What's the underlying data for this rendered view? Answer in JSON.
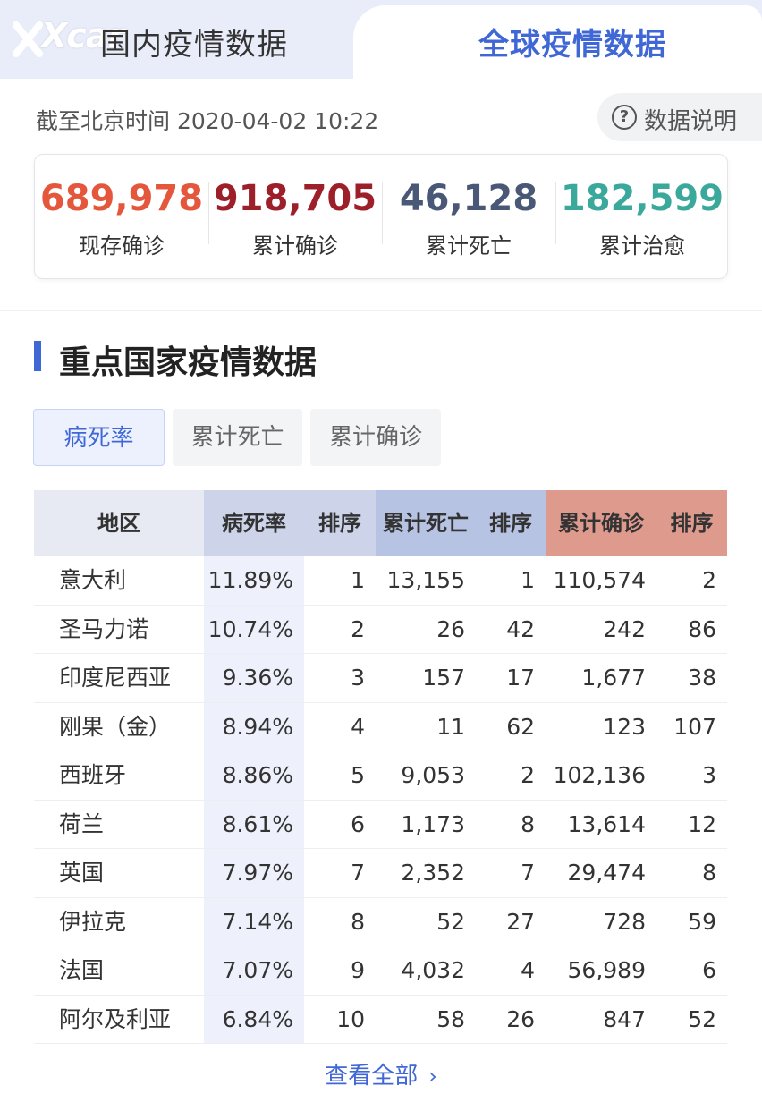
{
  "tabs": {
    "domestic": "国内疫情数据",
    "global": "全球疫情数据"
  },
  "logo": "Xcar",
  "header": {
    "timestamp": "截至北京时间 2020-04-02 10:22",
    "info_label": "数据说明",
    "info_icon": "?"
  },
  "stats": [
    {
      "value": "689,978",
      "label": "现存确诊",
      "color": "#e4573d"
    },
    {
      "value": "918,705",
      "label": "累计确诊",
      "color": "#9c1f2a"
    },
    {
      "value": "46,128",
      "label": "累计死亡",
      "color": "#4a5878"
    },
    {
      "value": "182,599",
      "label": "累计治愈",
      "color": "#3aa89a"
    }
  ],
  "section": {
    "title": "重点国家疫情数据"
  },
  "filters": [
    "病死率",
    "累计死亡",
    "累计确诊"
  ],
  "table": {
    "headers": [
      "地区",
      "病死率",
      "排序",
      "累计死亡",
      "排序",
      "累计确诊",
      "排序"
    ],
    "header_colors": [
      "#e7eaf3",
      "#cdd4ea",
      "#cdd4ea",
      "#b7c3e2",
      "#b7c3e2",
      "#de9a8d",
      "#de9a8d"
    ],
    "rows": [
      [
        "意大利",
        "11.89%",
        "1",
        "13,155",
        "1",
        "110,574",
        "2"
      ],
      [
        "圣马力诺",
        "10.74%",
        "2",
        "26",
        "42",
        "242",
        "86"
      ],
      [
        "印度尼西亚",
        "9.36%",
        "3",
        "157",
        "17",
        "1,677",
        "38"
      ],
      [
        "刚果（金）",
        "8.94%",
        "4",
        "11",
        "62",
        "123",
        "107"
      ],
      [
        "西班牙",
        "8.86%",
        "5",
        "9,053",
        "2",
        "102,136",
        "3"
      ],
      [
        "荷兰",
        "8.61%",
        "6",
        "1,173",
        "8",
        "13,614",
        "12"
      ],
      [
        "英国",
        "7.97%",
        "7",
        "2,352",
        "7",
        "29,474",
        "8"
      ],
      [
        "伊拉克",
        "7.14%",
        "8",
        "52",
        "27",
        "728",
        "59"
      ],
      [
        "法国",
        "7.07%",
        "9",
        "4,032",
        "4",
        "56,989",
        "6"
      ],
      [
        "阿尔及利亚",
        "6.84%",
        "10",
        "58",
        "26",
        "847",
        "52"
      ]
    ]
  },
  "more_label": "查看全部",
  "more_icon": "chevron-right-icon"
}
